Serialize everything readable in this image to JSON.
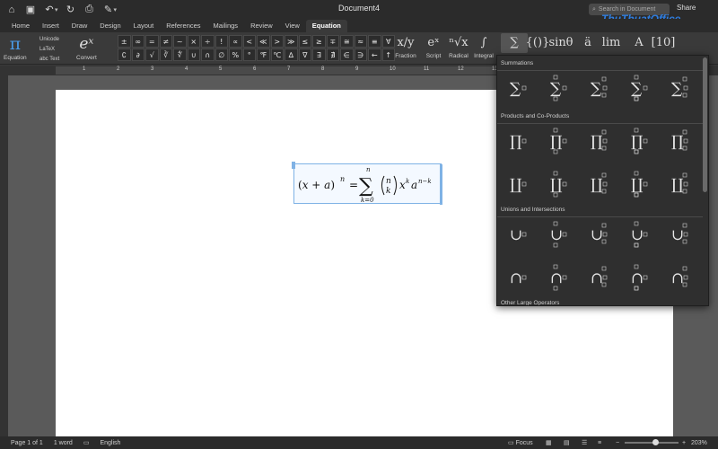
{
  "window": {
    "title": "Document4",
    "search_placeholder": "Search in Document",
    "share_label": "Share",
    "watermark": "ThuThuatOffice"
  },
  "tabs": [
    {
      "label": "Home",
      "active": false
    },
    {
      "label": "Insert",
      "active": false
    },
    {
      "label": "Draw",
      "active": false
    },
    {
      "label": "Design",
      "active": false
    },
    {
      "label": "Layout",
      "active": false
    },
    {
      "label": "References",
      "active": false
    },
    {
      "label": "Mailings",
      "active": false
    },
    {
      "label": "Review",
      "active": false
    },
    {
      "label": "View",
      "active": false
    },
    {
      "label": "Equation",
      "active": true
    }
  ],
  "ribbon": {
    "equation_label": "Equation",
    "equation_icon": "π",
    "formats": [
      "Unicode",
      "LaTeX",
      "abc Text"
    ],
    "convert_label": "Convert",
    "convert_icon": "eˣ",
    "symbols": [
      "±",
      "∞",
      "=",
      "≠",
      "~",
      "×",
      "÷",
      "!",
      "∝",
      "<",
      "≪",
      ">",
      "≫",
      "≤",
      "≥",
      "∓",
      "≅",
      "≈",
      "≡",
      "∀",
      "∁",
      "∂",
      "√",
      "∛",
      "∜",
      "∪",
      "∩",
      "∅",
      "%",
      "°",
      "℉",
      "℃",
      "∆",
      "∇",
      "∃",
      "∄",
      "∈",
      "∋",
      "←",
      "↑"
    ],
    "structures": [
      {
        "label": "Fraction",
        "icon": "x/y"
      },
      {
        "label": "Script",
        "icon": "eˣ"
      },
      {
        "label": "Radical",
        "icon": "ⁿ√x"
      },
      {
        "label": "Integral",
        "icon": "∫"
      },
      {
        "label": "",
        "icon": "∑"
      },
      {
        "label": "",
        "icon": "{()}"
      },
      {
        "label": "",
        "icon": "sinθ"
      },
      {
        "label": "",
        "icon": "ä"
      },
      {
        "label": "",
        "icon": "lim"
      },
      {
        "label": "",
        "icon": "A"
      },
      {
        "label": "",
        "icon": "[10]"
      }
    ]
  },
  "ruler_numbers": [
    "1",
    "2",
    "3",
    "4",
    "5",
    "6",
    "7",
    "8",
    "9",
    "10",
    "11",
    "12",
    "13"
  ],
  "equation": {
    "lhs_open": "(",
    "lhs_x": "x",
    "lhs_plus": " + ",
    "lhs_a": "a",
    "lhs_close": ")",
    "lhs_exp": "n",
    "equals": "=",
    "sum_symbol": "∑",
    "sum_upper": "n",
    "sum_lower": "k=0",
    "binom_top": "n",
    "binom_bottom": "k",
    "term_x": "x",
    "term_x_exp": "k",
    "term_a": "a",
    "term_a_exp": "n−k"
  },
  "gallery": {
    "sections": [
      {
        "title": "Summations",
        "symbol": "∑"
      },
      {
        "title": "Products and Co-Products",
        "symbol": "∏"
      },
      {
        "title": "Unions and Intersections",
        "symbol": "∪"
      },
      {
        "title": "Other Large Operators",
        "symbol": ""
      }
    ]
  },
  "status": {
    "page": "Page 1 of 1",
    "words": "1 word",
    "language": "English",
    "focus": "Focus",
    "zoom": "203%",
    "zoom_minus": "−",
    "zoom_plus": "+"
  }
}
